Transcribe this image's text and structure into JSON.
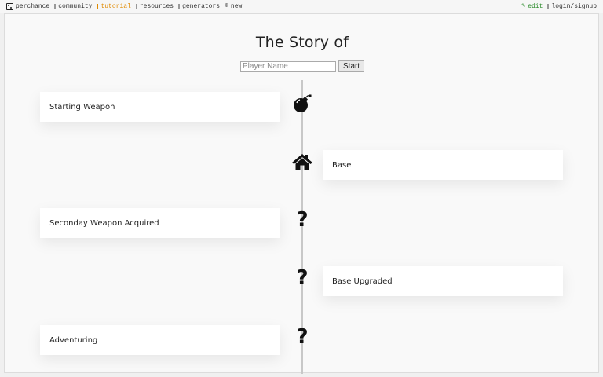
{
  "nav": {
    "left": [
      {
        "label": "perchance",
        "icon": "dice-icon",
        "active": false
      },
      {
        "label": "community",
        "icon": "chat-icon",
        "active": false
      },
      {
        "label": "tutorial",
        "icon": "book-icon",
        "active": true
      },
      {
        "label": "resources",
        "icon": "link-icon",
        "active": false
      },
      {
        "label": "generators",
        "icon": "list-icon",
        "active": false
      },
      {
        "label": "new",
        "icon": "plus-circle-icon",
        "active": false
      }
    ],
    "right": [
      {
        "label": "edit",
        "icon": "pencil-icon"
      },
      {
        "label": "login/signup",
        "icon": "user-icon"
      }
    ]
  },
  "page": {
    "title": "The Story of",
    "name_placeholder": "Player Name",
    "start_label": "Start"
  },
  "timeline": [
    {
      "side": "left",
      "label": "Starting Weapon",
      "icon": "bomb-icon"
    },
    {
      "side": "right",
      "label": "Base",
      "icon": "home-icon"
    },
    {
      "side": "left",
      "label": "Seconday Weapon Acquired",
      "icon": "question-icon"
    },
    {
      "side": "right",
      "label": "Base Upgraded",
      "icon": "question-icon"
    },
    {
      "side": "left",
      "label": "Adventuring",
      "icon": "question-icon"
    }
  ],
  "colors": {
    "active_nav": "#e08a00",
    "edit_nav": "#2a8a2a",
    "timeline_line": "#c8c8c8"
  }
}
